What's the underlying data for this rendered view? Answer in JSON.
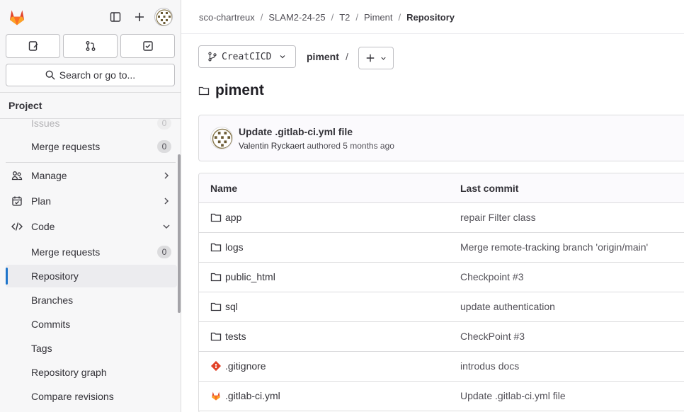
{
  "sidebar": {
    "search_label": "Search or go to...",
    "section_title": "Project",
    "items": [
      {
        "label": "Issues",
        "badge": "0"
      },
      {
        "label": "Merge requests",
        "badge": "0"
      },
      {
        "label": "Manage"
      },
      {
        "label": "Plan"
      },
      {
        "label": "Code"
      },
      {
        "label": "Merge requests",
        "badge": "0"
      },
      {
        "label": "Repository"
      },
      {
        "label": "Branches"
      },
      {
        "label": "Commits"
      },
      {
        "label": "Tags"
      },
      {
        "label": "Repository graph"
      },
      {
        "label": "Compare revisions"
      }
    ]
  },
  "breadcrumb": [
    "sco-chartreux",
    "SLAM2-24-25",
    "T2",
    "Piment",
    "Repository"
  ],
  "branch": "CreatCICD",
  "path_root": "piment",
  "path_sep": "/",
  "page_title": "piment",
  "last_commit": {
    "title": "Update .gitlab-ci.yml file",
    "author": "Valentin Ryckaert",
    "action": "authored",
    "time": "5 months ago"
  },
  "table": {
    "headers": [
      "Name",
      "Last commit"
    ],
    "rows": [
      {
        "name": "app",
        "type": "folder",
        "commit": "repair Filter class"
      },
      {
        "name": "logs",
        "type": "folder",
        "commit": "Merge remote-tracking branch 'origin/main'"
      },
      {
        "name": "public_html",
        "type": "folder",
        "commit": "Checkpoint #3"
      },
      {
        "name": "sql",
        "type": "folder",
        "commit": "update authentication"
      },
      {
        "name": "tests",
        "type": "folder",
        "commit": "CheckPoint #3"
      },
      {
        "name": ".gitignore",
        "type": "git",
        "commit": "introdus docs"
      },
      {
        "name": ".gitlab-ci.yml",
        "type": "gitlab",
        "commit": "Update .gitlab-ci.yml file"
      }
    ]
  },
  "colors": {
    "accent": "#1f75cb",
    "gitlab_orange": "#e24329",
    "git_orange": "#e24329"
  },
  "icons": [
    "gitlab-logo-icon",
    "sidebar-toggle-icon",
    "plus-icon",
    "issues-icon",
    "merge-request-icon",
    "todo-icon",
    "search-icon",
    "users-icon",
    "calendar-icon",
    "code-icon",
    "branch-icon",
    "folder-icon",
    "git-icon"
  ]
}
